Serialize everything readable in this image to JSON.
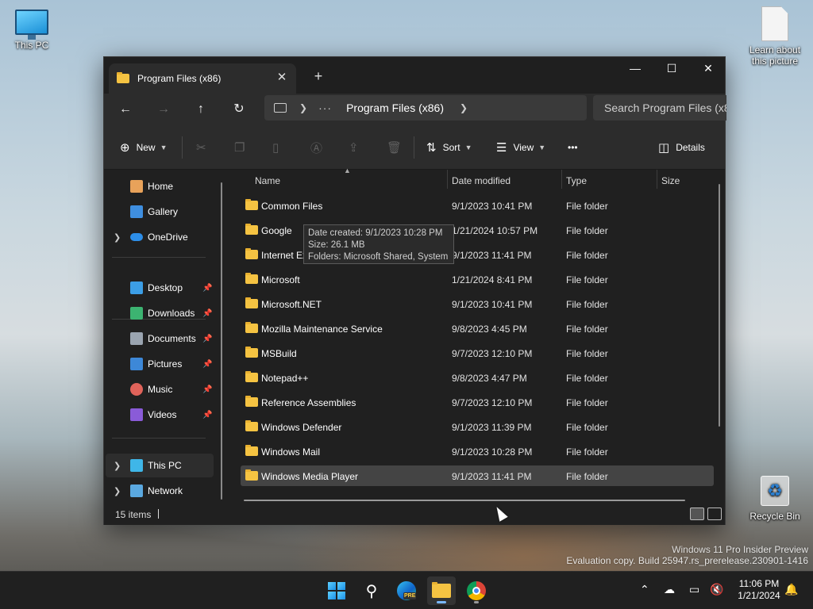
{
  "desktop": {
    "icons": [
      {
        "label": "This PC"
      },
      {
        "label": "Learn about this picture"
      },
      {
        "label": "Recycle Bin"
      }
    ],
    "watermark_line1": "Windows 11 Pro Insider Preview",
    "watermark_line2": "Evaluation copy. Build 25947.rs_prerelease.230901-1416"
  },
  "window": {
    "tab_title": "Program Files (x86)",
    "tab_close": "✕",
    "new_tab": "+",
    "controls": {
      "minimize": "—",
      "maximize": "☐",
      "close": "✕"
    }
  },
  "nav": {
    "back": "←",
    "forward": "→",
    "up": "↑",
    "refresh": "↻",
    "address_more": "···",
    "address_current": "Program Files (x86)",
    "search_placeholder": "Search Program Files (x86)"
  },
  "commands": {
    "new": "New",
    "sort": "Sort",
    "view": "View",
    "more": "•••",
    "details": "Details"
  },
  "sidebar": {
    "items": [
      {
        "label": "Home",
        "color": "#e8a25a"
      },
      {
        "label": "Gallery",
        "color": "#3f8fe0"
      },
      {
        "label": "OneDrive",
        "color": "#2d8ee8"
      },
      {
        "label": "Desktop",
        "color": "#3c9ee6"
      },
      {
        "label": "Downloads",
        "color": "#3cb371"
      },
      {
        "label": "Documents",
        "color": "#9aa4b0"
      },
      {
        "label": "Pictures",
        "color": "#3d88d8"
      },
      {
        "label": "Music",
        "color": "#e0635a"
      },
      {
        "label": "Videos",
        "color": "#8a5bd8"
      },
      {
        "label": "This PC",
        "color": "#3fb6e8"
      },
      {
        "label": "Network",
        "color": "#5aa8e0"
      }
    ]
  },
  "columns": {
    "name": "Name",
    "date": "Date modified",
    "type": "Type",
    "size": "Size"
  },
  "files": [
    {
      "name": "Common Files",
      "date": "9/1/2023 10:41 PM",
      "type": "File folder"
    },
    {
      "name": "Google",
      "date": "1/21/2024 10:57 PM",
      "type": "File folder"
    },
    {
      "name": "Internet Explorer",
      "date": "9/1/2023 11:41 PM",
      "type": "File folder"
    },
    {
      "name": "Microsoft",
      "date": "1/21/2024 8:41 PM",
      "type": "File folder"
    },
    {
      "name": "Microsoft.NET",
      "date": "9/1/2023 10:41 PM",
      "type": "File folder"
    },
    {
      "name": "Mozilla Maintenance Service",
      "date": "9/8/2023 4:45 PM",
      "type": "File folder"
    },
    {
      "name": "MSBuild",
      "date": "9/7/2023 12:10 PM",
      "type": "File folder"
    },
    {
      "name": "Notepad++",
      "date": "9/8/2023 4:47 PM",
      "type": "File folder"
    },
    {
      "name": "Reference Assemblies",
      "date": "9/7/2023 12:10 PM",
      "type": "File folder"
    },
    {
      "name": "Windows Defender",
      "date": "9/1/2023 11:39 PM",
      "type": "File folder"
    },
    {
      "name": "Windows Mail",
      "date": "9/1/2023 10:28 PM",
      "type": "File folder"
    },
    {
      "name": "Windows Media Player",
      "date": "9/1/2023 11:41 PM",
      "type": "File folder"
    }
  ],
  "tooltip": {
    "line1": "Date created: 9/1/2023 10:28 PM",
    "line2": "Size: 26.1 MB",
    "line3": "Folders: Microsoft Shared, System"
  },
  "status": {
    "items_count": "15 items"
  },
  "taskbar": {
    "edge_badge": "PRE",
    "time": "11:06 PM",
    "date": "1/21/2024"
  }
}
